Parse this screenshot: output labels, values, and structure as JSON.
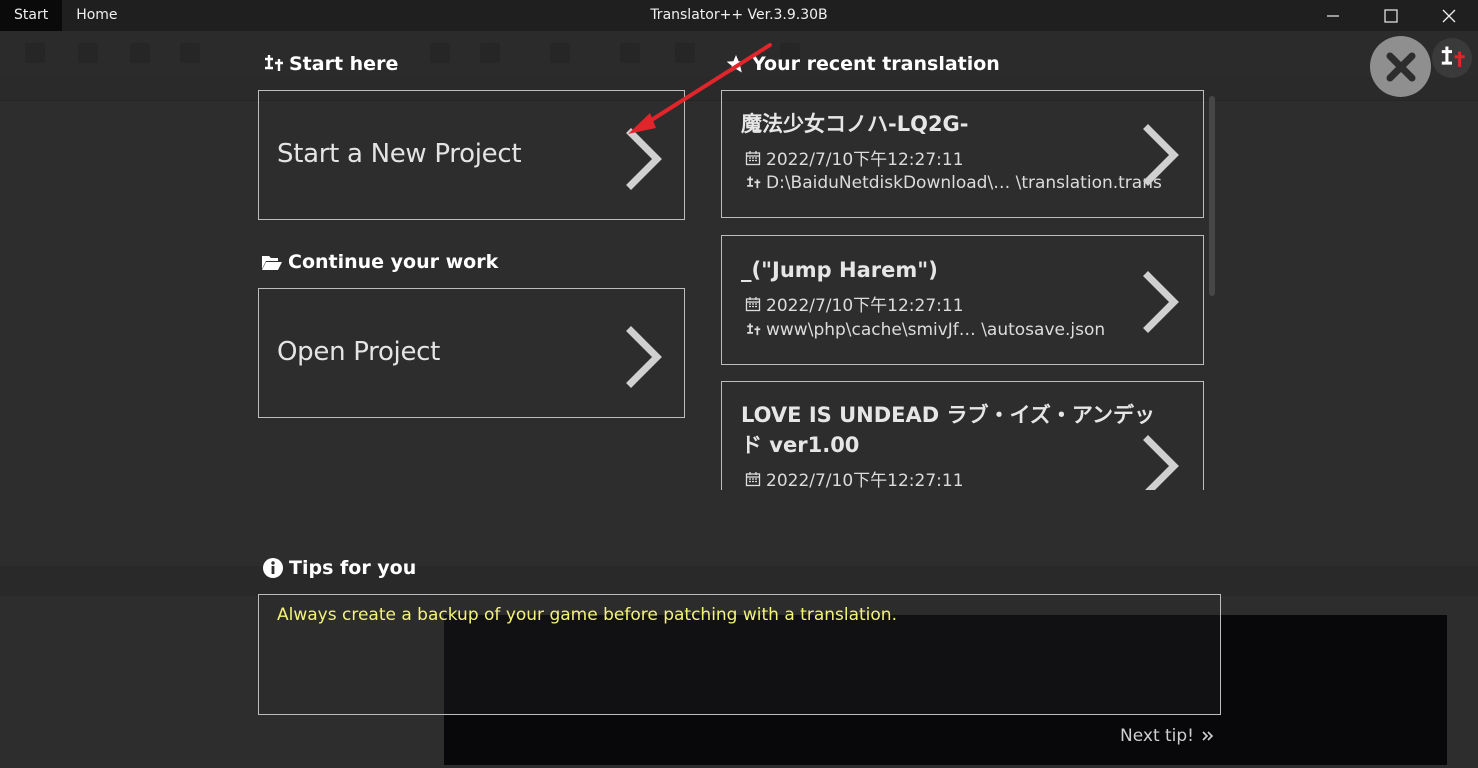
{
  "titlebar": {
    "tabs": [
      {
        "label": "Start"
      },
      {
        "label": "Home"
      }
    ],
    "title": "Translator++ Ver.3.9.30B"
  },
  "start_here": {
    "heading": "Start here",
    "new_project_label": "Start a New Project"
  },
  "continue_work": {
    "heading": "Continue your work",
    "open_project_label": "Open Project"
  },
  "recent": {
    "heading": "Your recent translation",
    "items": [
      {
        "title": "魔法少女コノハ-LQ2G-",
        "date": "2022/7/10下午12:27:11",
        "path": "D:\\BaiduNetdiskDownload\\… \\translation.trans"
      },
      {
        "title": "_(\"Jump Harem\")",
        "date": "2022/7/10下午12:27:11",
        "path": "www\\php\\cache\\smivJf… \\autosave.json"
      },
      {
        "title": "LOVE IS UNDEAD ラブ・イズ・アンデッド ver1.00",
        "date": "2022/7/10下午12:27:11",
        "path": ""
      }
    ]
  },
  "tips": {
    "heading": "Tips for you",
    "text": "Always create a backup of your game before patching with a translation.",
    "next_label": "Next tip!"
  },
  "colors": {
    "tip_text": "#f3f37a",
    "annotation_arrow": "#e0252b",
    "background": "#2d2d2d"
  }
}
